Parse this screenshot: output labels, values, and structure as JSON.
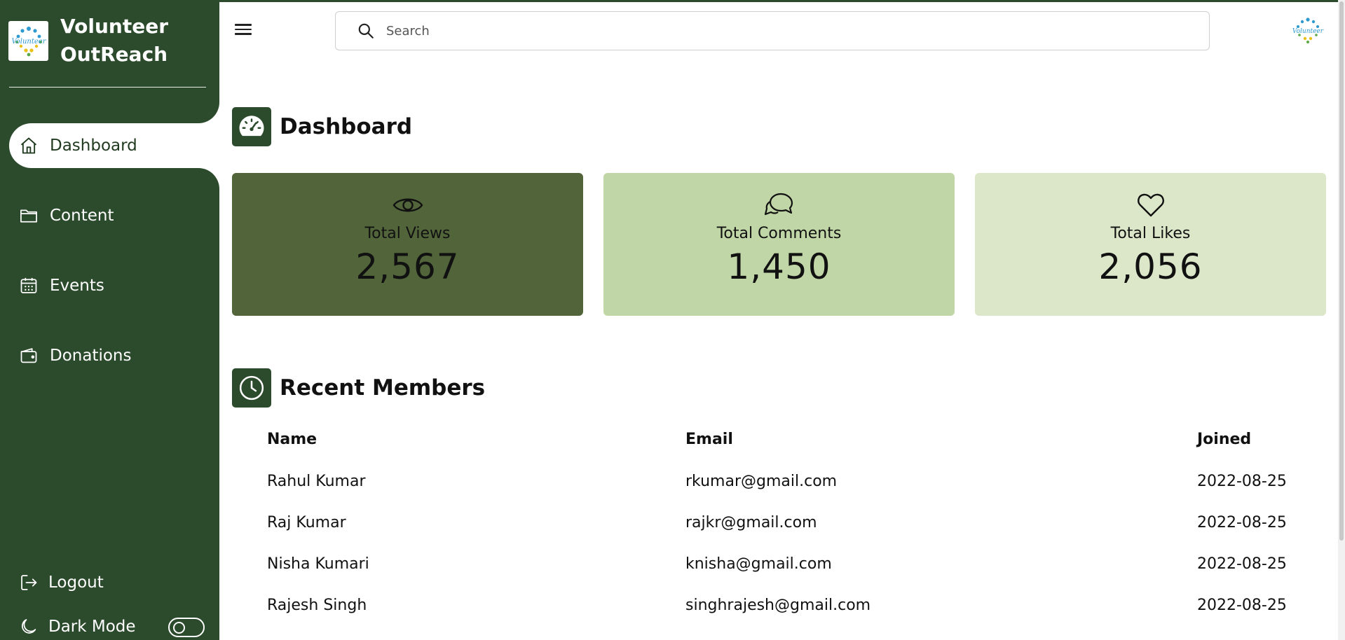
{
  "brand": {
    "name": "Volunteer OutReach",
    "logo_text": "Volunteer"
  },
  "sidebar": {
    "items": [
      {
        "label": "Dashboard",
        "icon": "home-icon",
        "active": true
      },
      {
        "label": "Content",
        "icon": "folder-icon",
        "active": false
      },
      {
        "label": "Events",
        "icon": "calendar-icon",
        "active": false
      },
      {
        "label": "Donations",
        "icon": "wallet-icon",
        "active": false
      }
    ],
    "logout_label": "Logout",
    "dark_mode_label": "Dark Mode",
    "dark_mode_on": false
  },
  "header": {
    "search_placeholder": "Search",
    "search_value": ""
  },
  "dashboard": {
    "title": "Dashboard",
    "stats": [
      {
        "label": "Total Views",
        "value": "2,567",
        "icon": "eye-icon",
        "color": "#52653a"
      },
      {
        "label": "Total Comments",
        "value": "1,450",
        "icon": "chat-bubbles-icon",
        "color": "#c1d6a6"
      },
      {
        "label": "Total Likes",
        "value": "2,056",
        "icon": "heart-icon",
        "color": "#dce7ca"
      }
    ]
  },
  "members": {
    "title": "Recent Members",
    "columns": [
      "Name",
      "Email",
      "Joined"
    ],
    "rows": [
      {
        "name": "Rahul Kumar",
        "email": "rkumar@gmail.com",
        "joined": "2022-08-25"
      },
      {
        "name": "Raj Kumar",
        "email": "rajkr@gmail.com",
        "joined": "2022-08-25"
      },
      {
        "name": "Nisha Kumari",
        "email": "knisha@gmail.com",
        "joined": "2022-08-25"
      },
      {
        "name": "Rajesh Singh",
        "email": "singhrajesh@gmail.com",
        "joined": "2022-08-25"
      }
    ]
  },
  "colors": {
    "sidebar_bg": "#2c4a2c",
    "accent": "#2c4a2c"
  }
}
